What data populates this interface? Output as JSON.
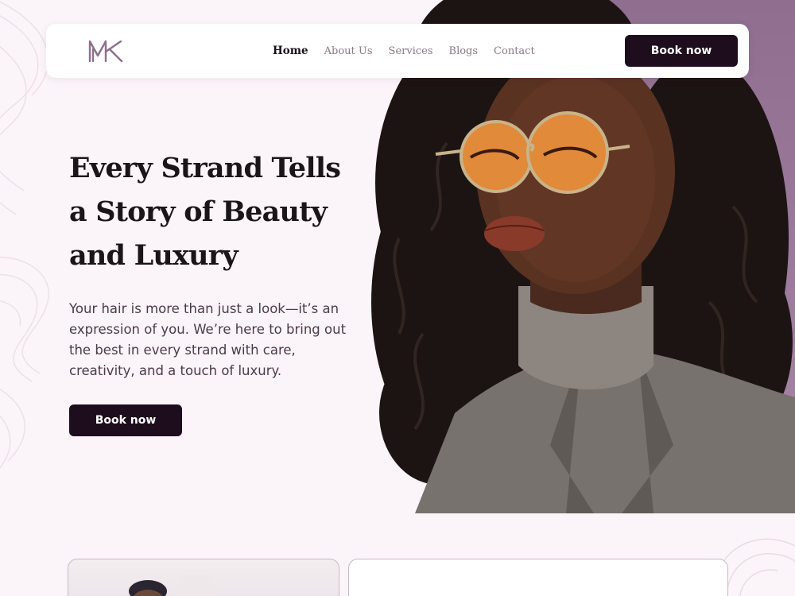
{
  "brand": {
    "logo_text": "MK",
    "accent": "#1e0d1c",
    "lavender": "#9b7a9c",
    "background": "#fbf4f8"
  },
  "nav": {
    "links": [
      {
        "label": "Home",
        "active": true
      },
      {
        "label": "About Us",
        "active": false
      },
      {
        "label": "Services",
        "active": false
      },
      {
        "label": "Blogs",
        "active": false
      },
      {
        "label": "Contact",
        "active": false
      }
    ],
    "cta_label": "Book now"
  },
  "hero": {
    "title": "Every Strand Tells a Story of Beauty and Luxury",
    "subtitle": "Your hair is more than just a look—it’s an expression of you. We’re here to bring out the best in every strand with care, creativity, and a touch of luxury.",
    "cta_label": "Book now",
    "image_subject": "portrait-woman-curly-hair-orange-sunglasses"
  },
  "icons": {
    "logo": "mk-monogram-logo",
    "decor": "swirl-pattern"
  }
}
